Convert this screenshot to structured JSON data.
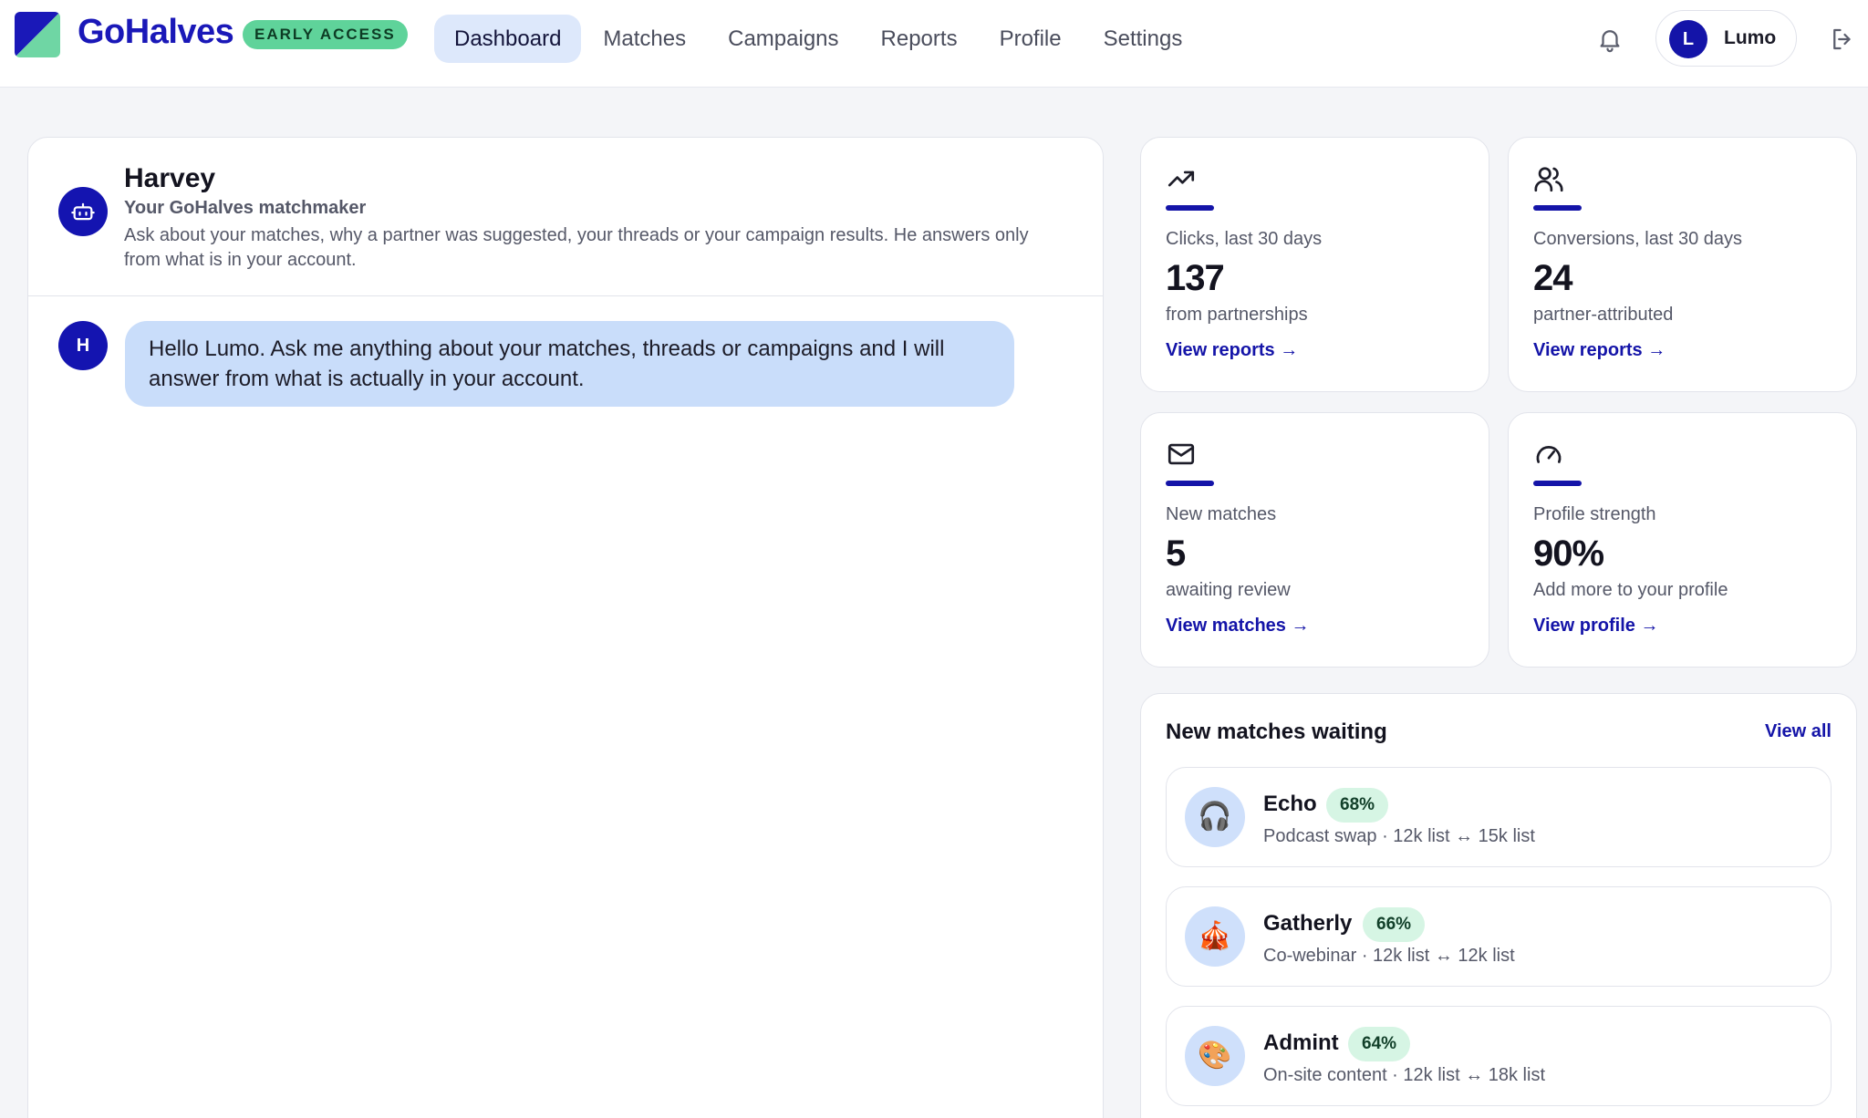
{
  "header": {
    "brand": "GoHalves",
    "badge": "EARLY ACCESS",
    "nav": [
      {
        "label": "Dashboard",
        "active": true
      },
      {
        "label": "Matches",
        "active": false
      },
      {
        "label": "Campaigns",
        "active": false
      },
      {
        "label": "Reports",
        "active": false
      },
      {
        "label": "Profile",
        "active": false
      },
      {
        "label": "Settings",
        "active": false
      }
    ],
    "user": {
      "initial": "L",
      "name": "Lumo"
    },
    "icons": {
      "notifications": "bell-icon",
      "logout": "logout-icon"
    }
  },
  "chat": {
    "assistant": {
      "name": "Harvey",
      "role": "Your GoHalves matchmaker",
      "description": "Ask about your matches, why a partner was suggested, your threads or your campaign results. He answers only from what is in your account.",
      "icon": "robot-icon"
    },
    "messages": [
      {
        "sender_initial": "H",
        "text": "Hello Lumo. Ask me anything about your matches, threads or campaigns and I will answer from what is actually in your account."
      }
    ]
  },
  "stats": [
    {
      "icon": "trend-up-icon",
      "label": "Clicks, last 30 days",
      "value": "137",
      "sub": "from partnerships",
      "link": "View reports →"
    },
    {
      "icon": "users-icon",
      "label": "Conversions, last 30 days",
      "value": "24",
      "sub": "partner-attributed",
      "link": "View reports →"
    },
    {
      "icon": "mail-icon",
      "label": "New matches",
      "value": "5",
      "sub": "awaiting review",
      "link": "View matches →"
    },
    {
      "icon": "gauge-icon",
      "label": "Profile strength",
      "value": "90%",
      "sub": "Add more to your profile",
      "link": "View profile →"
    }
  ],
  "matches_waiting": {
    "title": "New matches waiting",
    "view_all": "View all",
    "items": [
      {
        "emoji": "🎧",
        "name": "Echo",
        "score": "68%",
        "meta": "Podcast swap · 12k list ↔ 15k list"
      },
      {
        "emoji": "🎪",
        "name": "Gatherly",
        "score": "66%",
        "meta": "Co-webinar · 12k list ↔ 12k list"
      },
      {
        "emoji": "🎨",
        "name": "Admint",
        "score": "64%",
        "meta": "On-site content · 12k list ↔ 18k list"
      }
    ]
  },
  "colors": {
    "accent": "#1414a8",
    "brand": "#1a18b8",
    "badge": "#5fd39a",
    "bubble": "#c9ddfa",
    "score_bg": "#d6f5e4"
  }
}
